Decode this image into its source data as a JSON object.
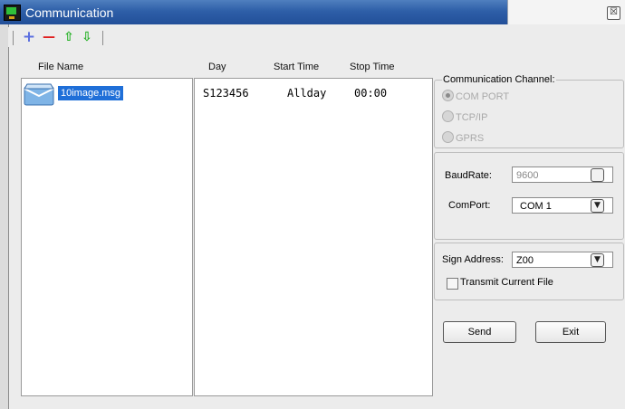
{
  "window": {
    "title": "Communication",
    "close_glyph": "☒"
  },
  "toolbar": {
    "add_glyph": "+",
    "remove_glyph": "—",
    "up_glyph": "⇧",
    "down_glyph": "⇩",
    "add_color": "#5b6fe0",
    "remove_color": "#e02020",
    "arrow_color": "#22b022"
  },
  "columns": {
    "file_name": "File Name",
    "day": "Day",
    "start_time": "Start Time",
    "stop_time": "Stop Time"
  },
  "files": [
    {
      "name": "10image.msg",
      "day": "S123456",
      "start": "Allday",
      "stop": "00:00",
      "selected": true
    }
  ],
  "channel": {
    "legend": "Communication Channel:",
    "options": [
      "COM PORT",
      "TCP/IP",
      "GPRS"
    ],
    "selected": "COM PORT"
  },
  "serial": {
    "baudrate_label": "BaudRate:",
    "baudrate_value": "9600",
    "comport_label": "ComPort:",
    "comport_value": "COM 1"
  },
  "sign": {
    "address_label": "Sign Address:",
    "address_value": "Z00",
    "transmit_label": "Transmit Current File",
    "transmit_checked": false
  },
  "actions": {
    "send": "Send",
    "exit": "Exit"
  },
  "colors": {
    "title_bar": "#2e5fa8",
    "selection": "#1f6fd8"
  }
}
